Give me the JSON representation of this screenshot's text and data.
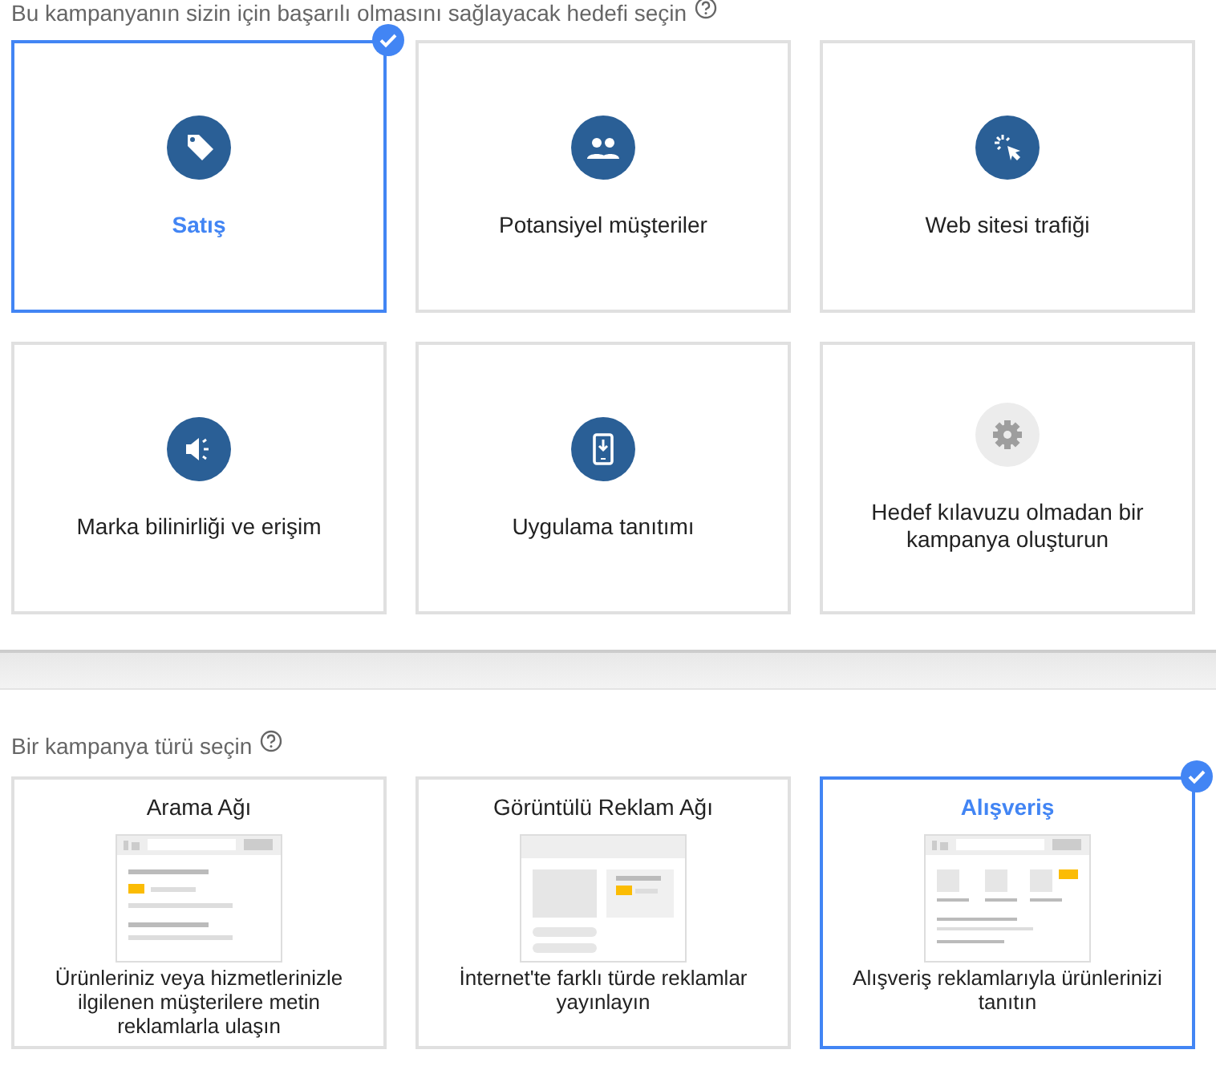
{
  "goal_heading": "Bu kampanyanın sizin için başarılı olmasını sağlayacak hedefi seçin",
  "goals": [
    {
      "label": "Satış",
      "kind": "tag",
      "selected": true
    },
    {
      "label": "Potansiyel müşteriler",
      "kind": "people",
      "selected": false
    },
    {
      "label": "Web sitesi trafiği",
      "kind": "click",
      "selected": false
    },
    {
      "label": "Marka bilinirliği ve erişim",
      "kind": "megaphone",
      "selected": false
    },
    {
      "label": "Uygulama tanıtımı",
      "kind": "phone",
      "selected": false
    },
    {
      "label": "Hedef kılavuzu olmadan bir kampanya oluşturun",
      "kind": "gear",
      "selected": false
    }
  ],
  "type_heading": "Bir kampanya türü seçin",
  "campaign_types": [
    {
      "title": "Arama Ağı",
      "description": "Ürünleriniz veya hizmetlerinizle ilgilenen müşterilere metin reklamlarla ulaşın",
      "kind": "search",
      "selected": false
    },
    {
      "title": "Görüntülü Reklam Ağı",
      "description": "İnternet'te farklı türde reklamlar yayınlayın",
      "kind": "display",
      "selected": false
    },
    {
      "title": "Alışveriş",
      "description": "Alışveriş reklamlarıyla ürünlerinizi tanıtın",
      "kind": "shopping",
      "selected": true
    }
  ]
}
